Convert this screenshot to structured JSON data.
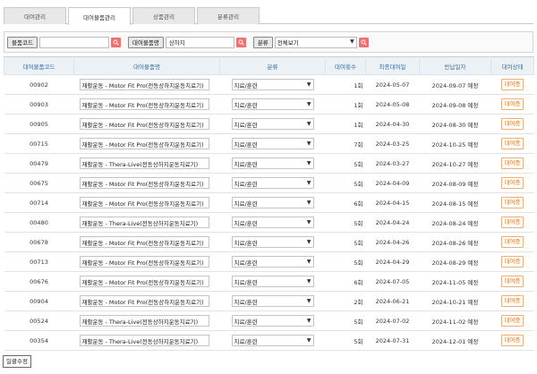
{
  "tabs": [
    {
      "label": "대여관리",
      "active": false
    },
    {
      "label": "대여물품관리",
      "active": true
    },
    {
      "label": "상품관리",
      "active": false
    },
    {
      "label": "분류관리",
      "active": false
    }
  ],
  "search": {
    "code_label": "물품코드",
    "code_value": "",
    "name_label": "대여물품명",
    "name_value": "상하지",
    "category_label": "분류",
    "category_value": "전체보기"
  },
  "table": {
    "headers": [
      "대여물품코드",
      "대여물품명",
      "분류",
      "대여횟수",
      "최종대여일",
      "반납일자",
      "대여상태"
    ],
    "rows": [
      {
        "code": "00902",
        "name": "재활운동 - Motor Fit Pro(전동상하지운동치료기)",
        "category": "치료/훈련",
        "count": "1회",
        "last": "2024-05-07",
        "return": "2024-09-07 예정",
        "status": "대여중"
      },
      {
        "code": "00903",
        "name": "재활운동 - Motor Fit Pro(전동상하지운동치료기)",
        "category": "치료/훈련",
        "count": "1회",
        "last": "2024-05-08",
        "return": "2024-09-08 예정",
        "status": "대여중"
      },
      {
        "code": "00905",
        "name": "재활운동 - Motor Fit Pro(전동상하지운동치료기)",
        "category": "치료/훈련",
        "count": "1회",
        "last": "2024-04-30",
        "return": "2024-08-30 예정",
        "status": "대여중"
      },
      {
        "code": "00715",
        "name": "재활운동 - Motor Fit Pro(전동상하지운동치료기)",
        "category": "치료/훈련",
        "count": "7회",
        "last": "2024-03-25",
        "return": "2024-10-25 예정",
        "status": "대여중"
      },
      {
        "code": "00479",
        "name": "재활운동 - Thera-Live(전동상하지운동치료기)",
        "category": "치료/훈련",
        "count": "5회",
        "last": "2024-03-27",
        "return": "2024-10-27 예정",
        "status": "대여중"
      },
      {
        "code": "00675",
        "name": "재활운동 - Motor Fit Pro(전동상하지운동치료기)",
        "category": "치료/훈련",
        "count": "5회",
        "last": "2024-04-09",
        "return": "2024-08-09 예정",
        "status": "대여중"
      },
      {
        "code": "00714",
        "name": "재활운동 - Motor Fit Pro(전동상하지운동치료기)",
        "category": "치료/훈련",
        "count": "6회",
        "last": "2024-04-15",
        "return": "2024-08-15 예정",
        "status": "대여중"
      },
      {
        "code": "00480",
        "name": "재활운동 - Thera-Live(전동상하지운동치료기)",
        "category": "치료/훈련",
        "count": "5회",
        "last": "2024-04-24",
        "return": "2024-08-24 예정",
        "status": "대여중"
      },
      {
        "code": "00678",
        "name": "재활운동 - Motor Fit Pro(전동상하지운동치료기)",
        "category": "치료/훈련",
        "count": "5회",
        "last": "2024-04-26",
        "return": "2024-08-26 예정",
        "status": "대여중"
      },
      {
        "code": "00713",
        "name": "재활운동 - Motor Fit Pro(전동상하지운동치료기)",
        "category": "치료/훈련",
        "count": "5회",
        "last": "2024-04-29",
        "return": "2024-08-29 예정",
        "status": "대여중"
      },
      {
        "code": "00676",
        "name": "재활운동 - Motor Fit Pro(전동상하지운동치료기)",
        "category": "치료/훈련",
        "count": "6회",
        "last": "2024-07-05",
        "return": "2024-11-05 예정",
        "status": "대여중"
      },
      {
        "code": "00904",
        "name": "재활운동 - Motor Fit Pro(전동상하지운동치료기)",
        "category": "치료/훈련",
        "count": "2회",
        "last": "2024-06-21",
        "return": "2024-10-21 예정",
        "status": "대여중"
      },
      {
        "code": "00524",
        "name": "재활운동 - Thera-Live(전동상하지운동치료기)",
        "category": "치료/훈련",
        "count": "5회",
        "last": "2024-07-02",
        "return": "2024-11-02 예정",
        "status": "대여중"
      },
      {
        "code": "00354",
        "name": "재활운동 - Thera-Live(전동상하지운동치료기)",
        "category": "치료/훈련",
        "count": "5회",
        "last": "2024-07-31",
        "return": "2024-12-01 예정",
        "status": "대여중"
      }
    ]
  },
  "footer": {
    "bulk_edit_label": "일괄수정"
  },
  "icons": {
    "search": "search-icon",
    "dropdown": "chevron-down-icon"
  },
  "colors": {
    "search_button": "#f07070",
    "header_text": "#3a6fa0",
    "status_orange": "#e07a2a"
  }
}
